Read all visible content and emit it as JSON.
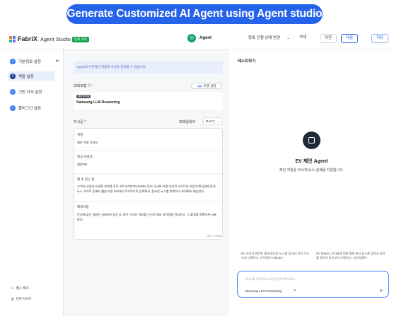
{
  "banner": {
    "title": "Generate Customized AI Agent using Agent studio"
  },
  "topbar": {
    "logo": "FabriX",
    "app_name": "Agent Studio",
    "badge": "등록 완료",
    "agent_label": "Agent",
    "status_select": "등록 진행 상태 변경",
    "delete_label": "삭제",
    "prev_label": "이전",
    "next_label": "다음",
    "save_label": "저장"
  },
  "sidebar": {
    "steps": [
      {
        "label": "기본정보 설정",
        "marker": "✓"
      },
      {
        "label": "역할 설정",
        "marker": "2"
      },
      {
        "label": "기반 지식 설정",
        "marker": "✓"
      },
      {
        "label": "플러그인 설정",
        "marker": "✓"
      }
    ],
    "footer": [
      {
        "label": "헬스 체크",
        "icon": "pulse-icon"
      },
      {
        "label": "연관 사이트",
        "icon": "link-icon"
      }
    ]
  },
  "editor": {
    "info_text": "Agent의 기본적인 역할과 속성을 정의할 수 있습니다.",
    "model_label": "대화모델 *",
    "model_button": "모델 설정",
    "model_button_tag": "Adv",
    "model_card_tag": "대화형모델",
    "model_name": "Samsung LLM-Reasoning",
    "instr_label": "지시문 *",
    "framework_label": "프레임워크",
    "framework_value": "RACC",
    "sections": [
      {
        "title": "역할",
        "body": "제안 지원 리서처"
      },
      {
        "title": "대상 사용자",
        "body": "제안PM"
      },
      {
        "title": "할 수 있는 일",
        "body": "고객사 사업과 유관한 자료를 주로 가트너/IDC/Forrester 등의 국내외 유명 리서치 사이트와 타임즈/한국경제 등의 뉴스 사이트 등에서 웹을 마킹 9시마다 주기적으로 검색해서, 중요한 뉴스를 번역하고 요약해서 제공한다"
      },
      {
        "title": "제약사항",
        "body": "문서에 없는 내용은 서술하지 않는다. 최신 기사와 자료를 근거로 해서 요약문을 작성하고, 그 출처를 정확하게 서술한다."
      }
    ],
    "char_count": "204 / 10000"
  },
  "test": {
    "title": "테스트하기",
    "agent_name": "EV 제안 Agent",
    "agent_desc": "제안 지원용 리서치/뉴스 검색을 지원합니다.",
    "suggestions": [
      "EV 사업과 관련된 올해 중요한 뉴스를 찾아서 최신 기사부터 나열하고, 기사별로 Indicato···",
      "EV Battery 신기술에 대한 올해 최신 뉴스를 찾아서 자료를 찾아서 최신부터 나열하고, 리서치별로···"
    ],
    "chat_placeholder": "메시지를 입력하거나 파일을 첨부해 보세요.",
    "chat_model": "Samsung LLM-Reasoning"
  },
  "colors": {
    "accent": "#2563eb",
    "agent_green": "#0f9f78",
    "active_step": "#1e3a8a"
  }
}
